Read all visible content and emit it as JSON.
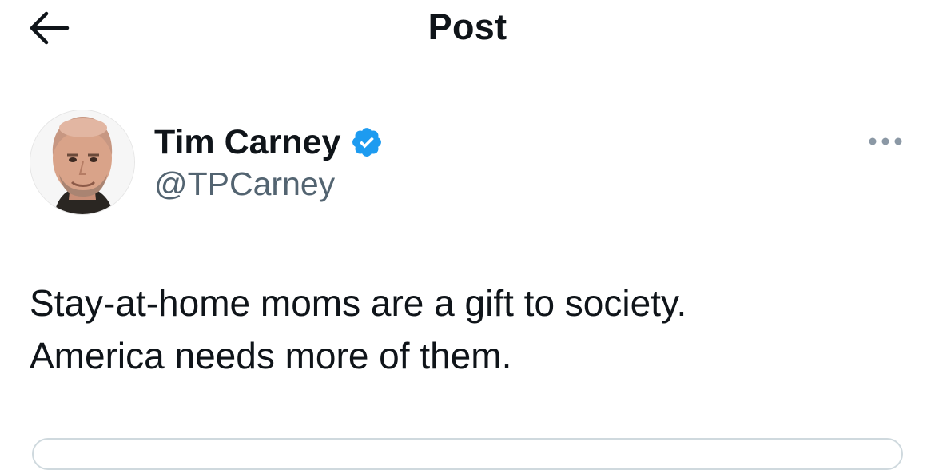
{
  "header": {
    "title": "Post",
    "back_icon": "arrow-left-icon"
  },
  "author": {
    "name": "Tim Carney",
    "handle": "@TPCarney",
    "verified_icon": "verified-badge-icon",
    "verified_color": "#1d9bf0"
  },
  "actions": {
    "more_icon": "more-options-icon"
  },
  "post": {
    "lines": [
      "Stay-at-home moms are a gift to society.",
      "America needs more of them."
    ]
  },
  "colors": {
    "text": "#0f1419",
    "secondary": "#536471",
    "accent": "#1d9bf0"
  }
}
